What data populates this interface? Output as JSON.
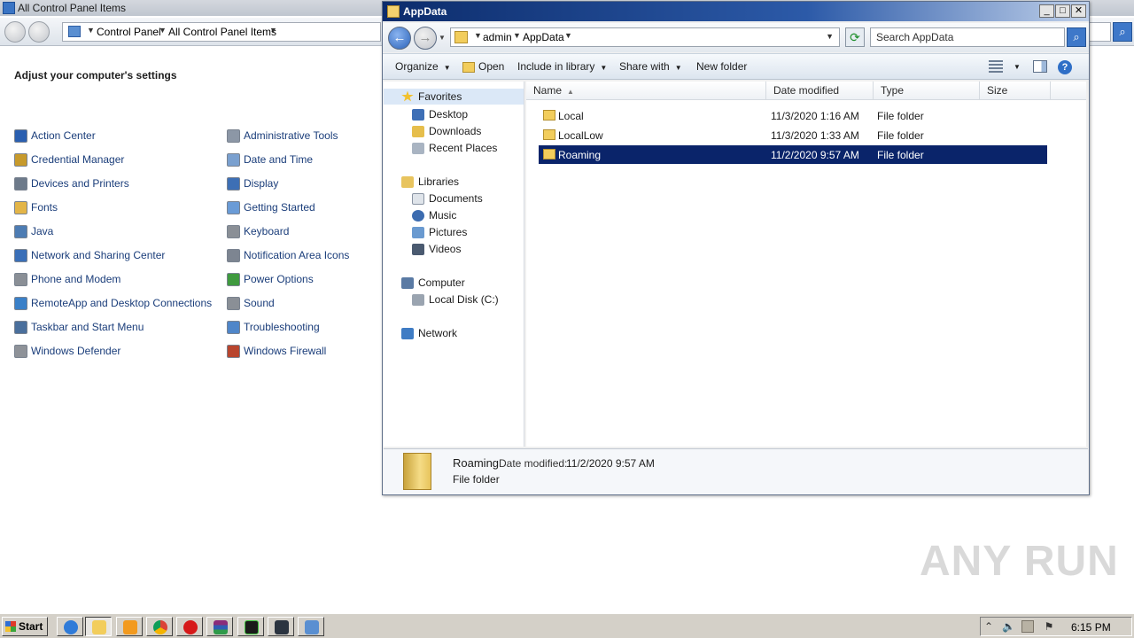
{
  "control_panel": {
    "title": "All Control Panel Items",
    "breadcrumb": [
      "Control Panel",
      "All Control Panel Items"
    ],
    "heading": "Adjust your computer's settings",
    "items_left": [
      {
        "label": "Action Center",
        "icon": "flag-icon",
        "color": "#2a5fb0"
      },
      {
        "label": "Credential Manager",
        "icon": "vault-icon",
        "color": "#c79a2c"
      },
      {
        "label": "Devices and Printers",
        "icon": "printer-icon",
        "color": "#6d7a8a"
      },
      {
        "label": "Fonts",
        "icon": "font-folder-icon",
        "color": "#e3b548"
      },
      {
        "label": "Java",
        "icon": "java-icon",
        "color": "#4d7cb3"
      },
      {
        "label": "Network and Sharing Center",
        "icon": "network-icon",
        "color": "#3a6fb8"
      },
      {
        "label": "Phone and Modem",
        "icon": "phone-icon",
        "color": "#8a8f96"
      },
      {
        "label": "RemoteApp and Desktop Connections",
        "icon": "remoteapp-icon",
        "color": "#3a80c8"
      },
      {
        "label": "Taskbar and Start Menu",
        "icon": "taskbar-icon",
        "color": "#4a6f9c"
      },
      {
        "label": "Windows Defender",
        "icon": "defender-icon",
        "color": "#8e9298"
      }
    ],
    "items_right": [
      {
        "label": "Administrative Tools",
        "icon": "admin-tools-icon",
        "color": "#8c97a6"
      },
      {
        "label": "Date and Time",
        "icon": "calendar-icon",
        "color": "#7aa0cf"
      },
      {
        "label": "Display",
        "icon": "monitor-icon",
        "color": "#3d6fb5"
      },
      {
        "label": "Getting Started",
        "icon": "getting-started-icon",
        "color": "#6a9bd6"
      },
      {
        "label": "Keyboard",
        "icon": "keyboard-icon",
        "color": "#8a8f96"
      },
      {
        "label": "Notification Area Icons",
        "icon": "notification-icon",
        "color": "#7d8591"
      },
      {
        "label": "Power Options",
        "icon": "power-icon",
        "color": "#3f9a3f"
      },
      {
        "label": "Sound",
        "icon": "speaker-icon",
        "color": "#8a8f96"
      },
      {
        "label": "Troubleshooting",
        "icon": "troubleshoot-icon",
        "color": "#4f86c9"
      },
      {
        "label": "Windows Firewall",
        "icon": "firewall-icon",
        "color": "#b8452e"
      }
    ]
  },
  "explorer": {
    "title": "AppData",
    "breadcrumb": [
      "admin",
      "AppData"
    ],
    "search_placeholder": "Search AppData",
    "toolbar": {
      "organize": "Organize",
      "open": "Open",
      "include_in_library": "Include in library",
      "share_with": "Share with",
      "new_folder": "New folder"
    },
    "nav": {
      "favorites": "Favorites",
      "desktop": "Desktop",
      "downloads": "Downloads",
      "recent_places": "Recent Places",
      "libraries": "Libraries",
      "documents": "Documents",
      "music": "Music",
      "pictures": "Pictures",
      "videos": "Videos",
      "computer": "Computer",
      "local_disk": "Local Disk (C:)",
      "network": "Network"
    },
    "columns": {
      "name": "Name",
      "date_modified": "Date modified",
      "type": "Type",
      "size": "Size"
    },
    "files": [
      {
        "name": "Local",
        "date": "11/3/2020 1:16 AM",
        "type": "File folder",
        "selected": false
      },
      {
        "name": "LocalLow",
        "date": "11/3/2020 1:33 AM",
        "type": "File folder",
        "selected": false
      },
      {
        "name": "Roaming",
        "date": "11/2/2020 9:57 AM",
        "type": "File folder",
        "selected": true
      }
    ],
    "details": {
      "name": "Roaming",
      "date_label": "Date modified:",
      "date": "11/2/2020 9:57 AM",
      "type": "File folder"
    }
  },
  "watermark": "ANY RUN",
  "taskbar": {
    "start": "Start",
    "clock": "6:15 PM"
  },
  "colors": {
    "selection": "#0a246a",
    "titlebar": "#0c2c6c"
  }
}
